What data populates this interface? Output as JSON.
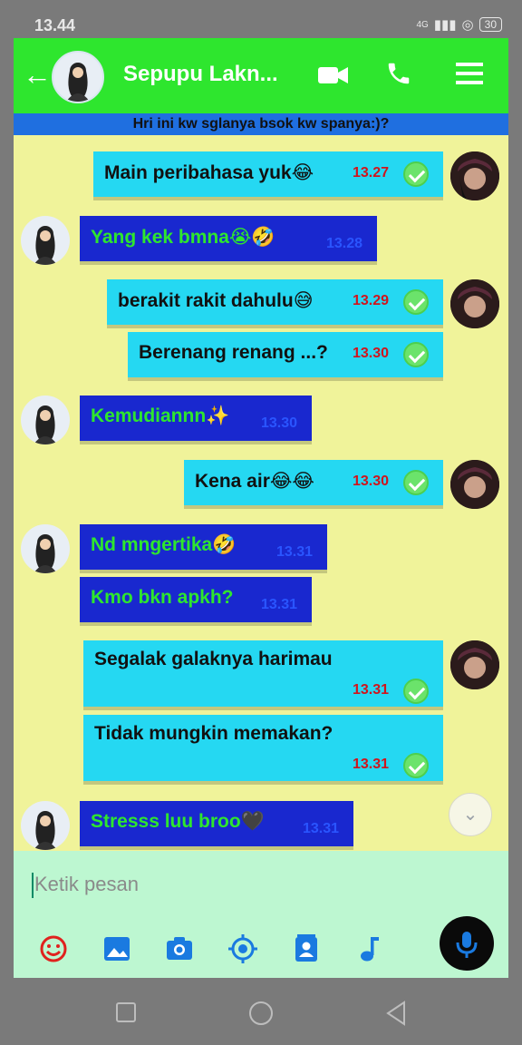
{
  "status": {
    "time": "13.44",
    "network": "4G",
    "battery": "30"
  },
  "header": {
    "title": "Sepupu Lakn..."
  },
  "banner": "Hri ini kw sglanya bsok kw spanya:)?",
  "messages": [
    {
      "dir": "out",
      "text": "Main peribahasa yuk😂",
      "time": "13.27"
    },
    {
      "dir": "in",
      "text": "Yang kek bmna😭🤣",
      "time": "13.28"
    },
    {
      "dir": "out",
      "text": "berakit rakit dahulu😅",
      "time": "13.29"
    },
    {
      "dir": "out",
      "text": "Berenang renang ...?",
      "time": "13.30"
    },
    {
      "dir": "in",
      "text": "Kemudiannn✨",
      "time": "13.30"
    },
    {
      "dir": "out",
      "text": "Kena air😂😂",
      "time": "13.30"
    },
    {
      "dir": "in",
      "text": "Nd mngertika🤣",
      "time": "13.31"
    },
    {
      "dir": "in",
      "text": "Kmo bkn apkh?",
      "time": "13.31"
    },
    {
      "dir": "out",
      "text": "Segalak galaknya harimau",
      "time": "13.31"
    },
    {
      "dir": "out",
      "text": "Tidak mungkin memakan?",
      "time": "13.31"
    },
    {
      "dir": "in",
      "text": "Stresss luu broo🖤",
      "time": "13.31"
    }
  ],
  "input": {
    "placeholder": "Ketik pesan"
  },
  "colors": {
    "appbar": "#2ee62e",
    "banner": "#1f6fe0",
    "chat_bg": "#f0f39a",
    "outgoing": "#25d8f2",
    "incoming": "#1928cf",
    "incoming_text": "#2ee62e",
    "input_bar": "#bdf7d1"
  }
}
